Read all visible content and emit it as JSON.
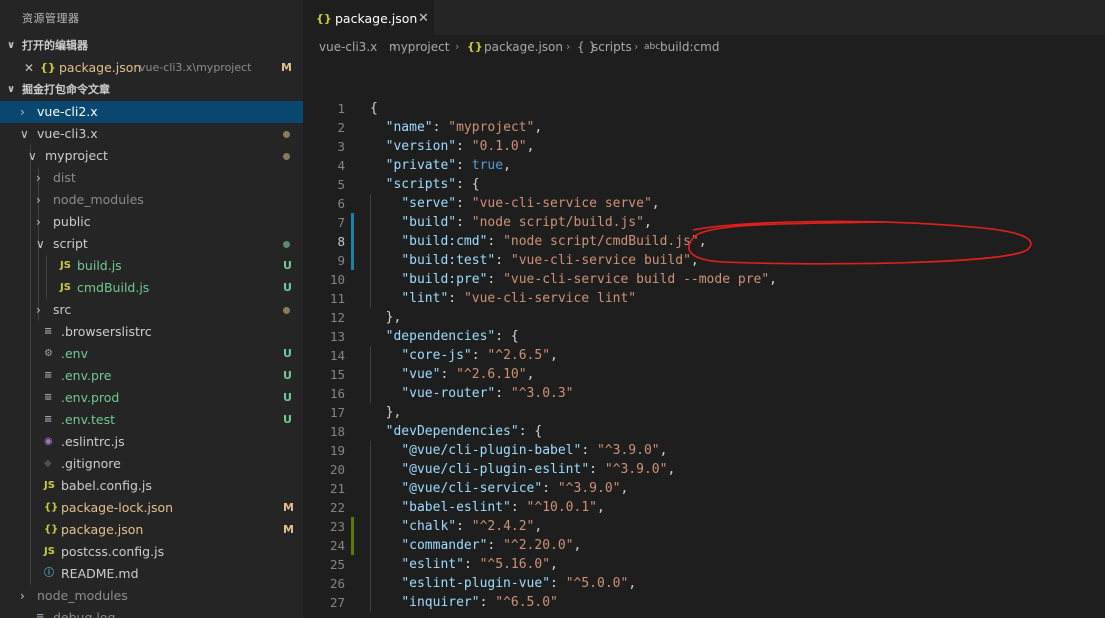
{
  "explorer": {
    "title": "资源管理器",
    "open_editors_header": "打开的编辑器",
    "open_editor": {
      "name": "package.json",
      "path": "vue-cli3.x\\myproject",
      "status": "M"
    },
    "workspace_header": "掘金打包命令文章",
    "tree": [
      {
        "label": "vue-cli2.x",
        "kind": "folder",
        "expanded": false
      },
      {
        "label": "vue-cli3.x",
        "kind": "folder",
        "expanded": true
      },
      {
        "label": "myproject",
        "kind": "folder",
        "expanded": true
      },
      {
        "label": "dist",
        "kind": "folder",
        "expanded": false
      },
      {
        "label": "node_modules",
        "kind": "folder",
        "expanded": false
      },
      {
        "label": "public",
        "kind": "folder",
        "expanded": false
      },
      {
        "label": "script",
        "kind": "folder",
        "expanded": true
      },
      {
        "label": "build.js",
        "kind": "js",
        "status": "U"
      },
      {
        "label": "cmdBuild.js",
        "kind": "js",
        "status": "U"
      },
      {
        "label": "src",
        "kind": "folder",
        "expanded": false
      },
      {
        "label": ".browserslistrc",
        "kind": "text"
      },
      {
        "label": ".env",
        "kind": "gear",
        "status": "U"
      },
      {
        "label": ".env.pre",
        "kind": "text",
        "status": "U"
      },
      {
        "label": ".env.prod",
        "kind": "text",
        "status": "U"
      },
      {
        "label": ".env.test",
        "kind": "text",
        "status": "U"
      },
      {
        "label": ".eslintrc.js",
        "kind": "eslint"
      },
      {
        "label": ".gitignore",
        "kind": "git"
      },
      {
        "label": "babel.config.js",
        "kind": "js"
      },
      {
        "label": "package-lock.json",
        "kind": "json",
        "status": "M"
      },
      {
        "label": "package.json",
        "kind": "json",
        "status": "M"
      },
      {
        "label": "postcss.config.js",
        "kind": "js"
      },
      {
        "label": "README.md",
        "kind": "info"
      },
      {
        "label": "node_modules",
        "kind": "folder",
        "expanded": false
      },
      {
        "label": "debug.log",
        "kind": "text"
      }
    ]
  },
  "tab": {
    "icon": "{}",
    "label": "package.json",
    "close": "✕"
  },
  "breadcrumb": [
    "vue-cli3.x",
    "myproject",
    "package.json",
    "scripts",
    "build:cmd"
  ],
  "code": {
    "active_line": 8,
    "lines": [
      "{",
      "  \"name\": \"myproject\",",
      "  \"version\": \"0.1.0\",",
      "  \"private\": true,",
      "  \"scripts\": {",
      "    \"serve\": \"vue-cli-service serve\",",
      "    \"build\": \"node script/build.js\",",
      "    \"build:cmd\": \"node script/cmdBuild.js\",",
      "    \"build:test\": \"vue-cli-service build\",",
      "    \"build:pre\": \"vue-cli-service build --mode pre\",",
      "    \"lint\": \"vue-cli-service lint\"",
      "  },",
      "  \"dependencies\": {",
      "    \"core-js\": \"^2.6.5\",",
      "    \"vue\": \"^2.6.10\",",
      "    \"vue-router\": \"^3.0.3\"",
      "  },",
      "  \"devDependencies\": {",
      "    \"@vue/cli-plugin-babel\": \"^3.9.0\",",
      "    \"@vue/cli-plugin-eslint\": \"^3.9.0\",",
      "    \"@vue/cli-service\": \"^3.9.0\",",
      "    \"babel-eslint\": \"^10.0.1\",",
      "    \"chalk\": \"^2.4.2\",",
      "    \"commander\": \"^2.20.0\",",
      "    \"eslint\": \"^5.16.0\",",
      "    \"eslint-plugin-vue\": \"^5.0.0\",",
      "    \"inquirer\": \"^6.5.0\""
    ],
    "modified_lines": [
      7,
      8,
      9
    ],
    "added_lines": [
      23,
      24
    ]
  },
  "colors": {
    "added": "#587c0c",
    "modified": "#1b81a8",
    "untracked": "#73c991",
    "git_modified": "#e2c08d",
    "annotation": "#e0201c"
  }
}
